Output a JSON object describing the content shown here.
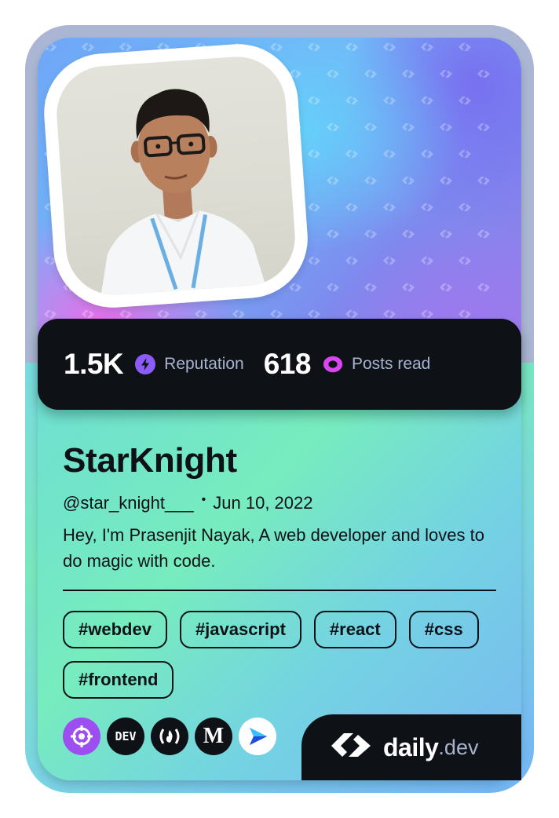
{
  "profile": {
    "name": "StarKnight",
    "handle": "@star_knight___",
    "separator": "•",
    "joined": "Jun 10, 2022",
    "bio": "Hey, I'm Prasenjit Nayak, A web developer and loves to do magic with code."
  },
  "stats": {
    "reputation_value": "1.5K",
    "reputation_label": "Reputation",
    "posts_value": "618",
    "posts_label": "Posts read"
  },
  "tags": [
    "#webdev",
    "#javascript",
    "#react",
    "#css",
    "#frontend"
  ],
  "socials": [
    {
      "icon": "crosshair-icon",
      "color": "#9d4ef0",
      "text": ""
    },
    {
      "icon": "dev-icon",
      "color": "#0e1217",
      "text": "DEV"
    },
    {
      "icon": "freecodecamp-icon",
      "color": "#0e1217",
      "text": "(🔥)"
    },
    {
      "icon": "medium-icon",
      "color": "#0e1217",
      "text": "M"
    },
    {
      "icon": "hashnode-send-icon",
      "color": "#ffffff",
      "text": ""
    }
  ],
  "brand": {
    "daily": "daily",
    "dev": ".dev"
  },
  "colors": {
    "accent_purple": "#8b5cf6",
    "accent_pink": "#d946ef",
    "dark": "#0e1217",
    "muted": "#a8b3cf"
  }
}
